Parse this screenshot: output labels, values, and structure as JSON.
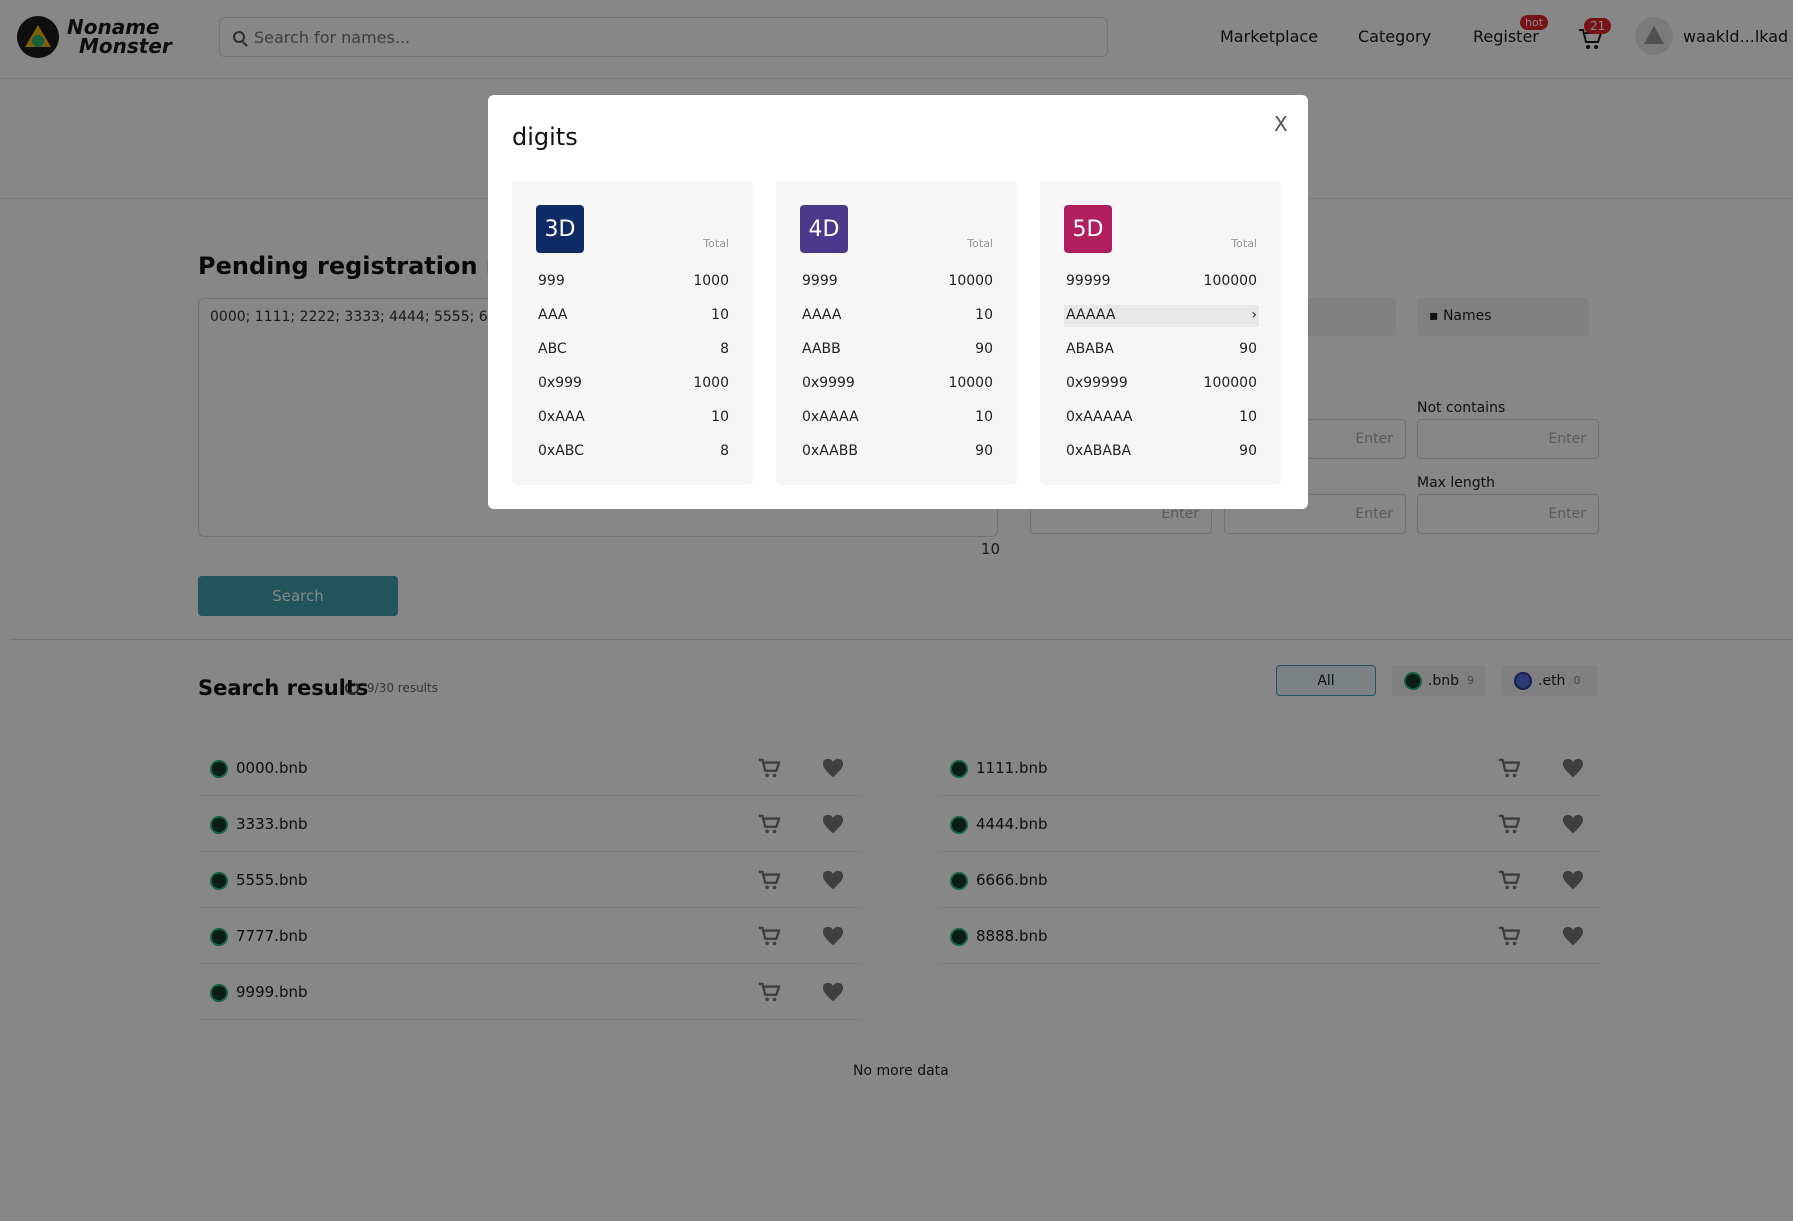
{
  "header": {
    "logo_line1": "Noname",
    "logo_line2": "Monster",
    "search_placeholder": "Search for names...",
    "nav": [
      "Marketplace",
      "Category",
      "Register"
    ],
    "hot_badge": "hot",
    "cart_count": "21",
    "username": "waakld...lkad"
  },
  "pending": {
    "title": "Pending registration names",
    "names": "0000; 1111; 2222; 3333; 4444; 5555; 6666",
    "count": "10",
    "search_button": "Search"
  },
  "filters": {
    "names_tab": "Names",
    "not_contains_label": "Not contains",
    "max_length_label": "Max length",
    "field_placeholder": "Enter"
  },
  "results": {
    "title": "Search results",
    "count": "9/30 results",
    "tlds": [
      {
        "label": "All",
        "count": ""
      },
      {
        "label": ".bnb",
        "count": "9"
      },
      {
        "label": ".eth",
        "count": "0"
      }
    ],
    "items": [
      "0000.bnb",
      "1111.bnb",
      "3333.bnb",
      "4444.bnb",
      "5555.bnb",
      "6666.bnb",
      "7777.bnb",
      "8888.bnb",
      "9999.bnb"
    ],
    "footer": "No more data"
  },
  "modal": {
    "title": "digits",
    "close": "X",
    "total_label": "Total",
    "cards": [
      {
        "icon": "3D",
        "color": "#0f2b66",
        "rows": [
          {
            "k": "999",
            "v": "1000"
          },
          {
            "k": "AAA",
            "v": "10"
          },
          {
            "k": "ABC",
            "v": "8"
          },
          {
            "k": "0x999",
            "v": "1000"
          },
          {
            "k": "0xAAA",
            "v": "10"
          },
          {
            "k": "0xABC",
            "v": "8"
          }
        ]
      },
      {
        "icon": "4D",
        "color": "#4b3a8c",
        "rows": [
          {
            "k": "9999",
            "v": "10000"
          },
          {
            "k": "AAAA",
            "v": "10"
          },
          {
            "k": "AABB",
            "v": "90"
          },
          {
            "k": "0x9999",
            "v": "10000"
          },
          {
            "k": "0xAAAA",
            "v": "10"
          },
          {
            "k": "0xAABB",
            "v": "90"
          }
        ]
      },
      {
        "icon": "5D",
        "color": "#b01e5e",
        "rows": [
          {
            "k": "99999",
            "v": "100000"
          },
          {
            "k": "AAAAA",
            "v": "›"
          },
          {
            "k": "ABABA",
            "v": "90"
          },
          {
            "k": "0x99999",
            "v": "100000"
          },
          {
            "k": "0xAAAAA",
            "v": "10"
          },
          {
            "k": "0xABABA",
            "v": "90"
          }
        ]
      }
    ]
  }
}
